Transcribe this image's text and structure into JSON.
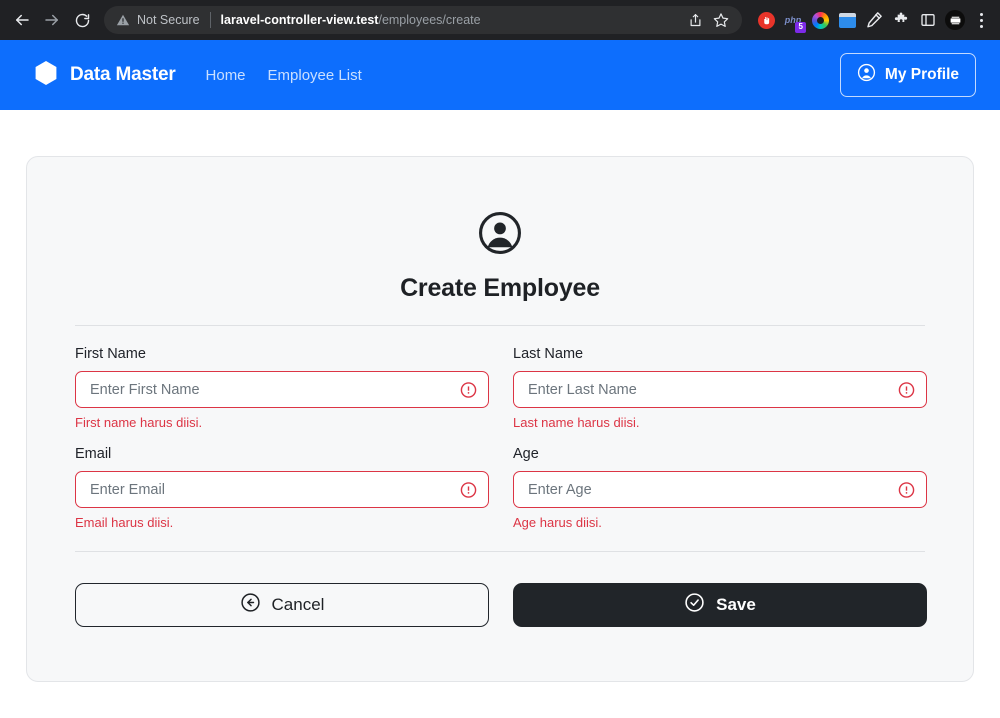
{
  "browser": {
    "back_label": "back-arrow",
    "forward_label": "forward-arrow",
    "reload_label": "reload",
    "security_label": "Not Secure",
    "url_host": "laravel-controller-view.test",
    "url_path": "/employees/create",
    "share_label": "share-icon",
    "bookmark_label": "star-icon",
    "extensions": [
      {
        "name": "stop-extension-icon",
        "label": ""
      },
      {
        "name": "php-extension-icon",
        "label": "php",
        "badge": "5"
      },
      {
        "name": "color-ring-extension-icon",
        "label": ""
      },
      {
        "name": "window-extension-icon",
        "label": ""
      },
      {
        "name": "pen-extension-icon",
        "label": ""
      },
      {
        "name": "puzzle-extension-icon",
        "label": ""
      },
      {
        "name": "sidebar-toggle-icon",
        "label": ""
      },
      {
        "name": "profile-avatar-icon",
        "label": ""
      }
    ],
    "menu_label": "chrome-menu"
  },
  "navbar": {
    "brand": "Data Master",
    "logo_icon": "hexagon-icon",
    "links": [
      {
        "label": "Home"
      },
      {
        "label": "Employee List"
      }
    ],
    "profile_button": {
      "label": "My Profile",
      "icon": "user-circle-icon"
    }
  },
  "card": {
    "header_icon": "user-avatar-icon",
    "title": "Create Employee",
    "fields": [
      {
        "label": "First Name",
        "placeholder": "Enter First Name",
        "value": "",
        "error": "First name harus diisi.",
        "icon": "error-circle-icon",
        "name": "first-name"
      },
      {
        "label": "Last Name",
        "placeholder": "Enter Last Name",
        "value": "",
        "error": "Last name harus diisi.",
        "icon": "error-circle-icon",
        "name": "last-name"
      },
      {
        "label": "Email",
        "placeholder": "Enter Email",
        "value": "",
        "error": "Email harus diisi.",
        "icon": "error-circle-icon",
        "name": "email"
      },
      {
        "label": "Age",
        "placeholder": "Enter Age",
        "value": "",
        "error": "Age harus diisi.",
        "icon": "error-circle-icon",
        "name": "age"
      }
    ],
    "cancel_button": {
      "label": "Cancel",
      "icon": "arrow-left-circle-icon"
    },
    "save_button": {
      "label": "Save",
      "icon": "check-circle-icon"
    }
  },
  "colors": {
    "brand_blue": "#0d6efd",
    "danger_red": "#dc3545",
    "dark": "#212529",
    "card_bg": "#f7f8f9"
  }
}
